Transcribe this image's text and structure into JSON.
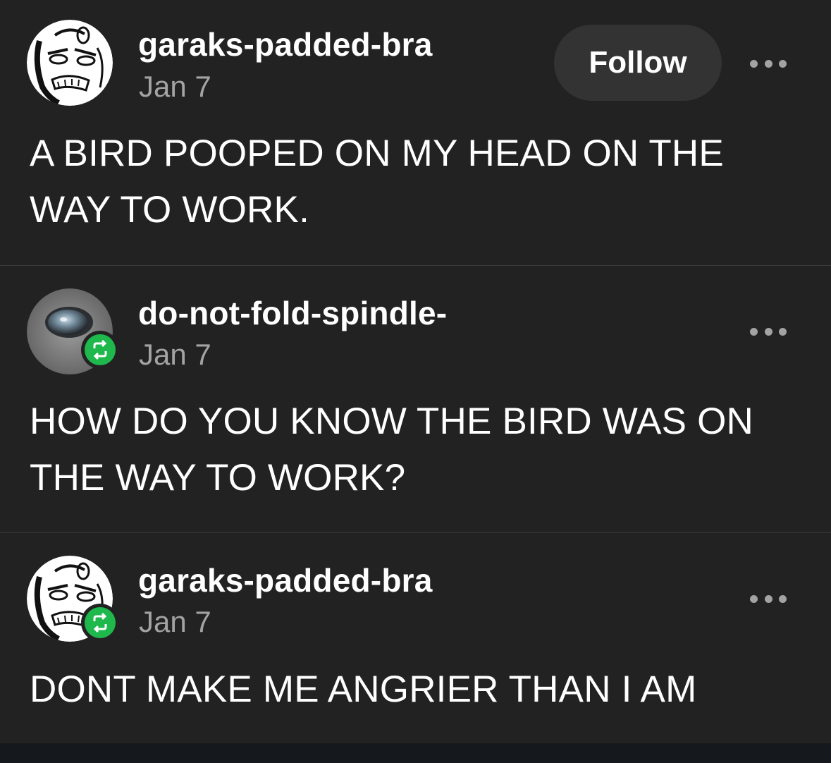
{
  "posts": [
    {
      "username": "garaks-padded-bra",
      "date": "Jan 7",
      "follow_label": "Follow",
      "avatar": "cartoon-face-avatar",
      "lines": [
        "A BIRD POOPED ON MY HEAD ON THE",
        "WAY TO WORK."
      ]
    },
    {
      "username": "do-not-fold-spindle-",
      "date": "Jan 7",
      "avatar": "animal-eye-avatar",
      "badge": "reblog-icon",
      "lines": [
        "HOW DO YOU KNOW THE BIRD WAS ON",
        "THE WAY TO WORK?"
      ]
    },
    {
      "username": "garaks-padded-bra",
      "date": "Jan 7",
      "avatar": "cartoon-face-avatar",
      "badge": "reblog-icon",
      "lines": [
        "DONT MAKE ME ANGRIER THAN I AM"
      ]
    }
  ],
  "colors": {
    "background": "#222222",
    "divider": "#3a3a3a",
    "reblog_green": "#1fb84c",
    "meta_gray": "#a3a3a3",
    "follow_bg": "#333333"
  }
}
